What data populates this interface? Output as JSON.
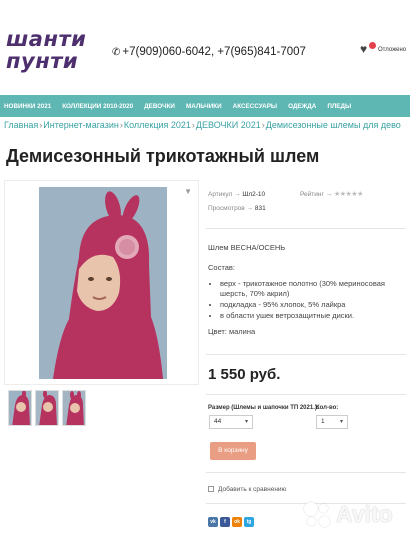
{
  "header": {
    "logo_line1": "шанти",
    "logo_line2": "пунти",
    "phones": "+7(909)060-6042, +7(965)841-7007",
    "wishlist_label": "Отложено"
  },
  "nav": {
    "items": [
      "Новинки 2021",
      "Коллекции 2010-2020",
      "Девочки",
      "Мальчики",
      "Аксессуары",
      "Одежда",
      "Пледы"
    ]
  },
  "breadcrumb": {
    "items": [
      "Главная",
      "Интернет-магазин",
      "Коллекция 2021",
      "ДЕВОЧКИ 2021",
      "Демисезонные шлемы для дево"
    ]
  },
  "product": {
    "title": "Демисезонный трикотажный шлем",
    "article_label": "Артикул →",
    "article_value": "Шл2-10",
    "views_label": "Просмотров →",
    "views_value": "831",
    "rating_label": "Рейтинг →",
    "description": {
      "season": "Шлем ВЕСНА/ОСЕНЬ",
      "composition_label": "Состав:",
      "composition_items": [
        "верх - трикотажное полотно (30% мериносовая шерсть, 70% акрил)",
        "подкладка - 95% хлопок, 5% лайкра",
        "в области ушек ветрозащитные диски."
      ],
      "color": "Цвет: малина"
    },
    "price": "1 550 руб.",
    "size_label": "Размер (Шлемы и шапочки ТП 2021.):",
    "size_value": "44",
    "qty_label": "Кол-во:",
    "qty_value": "1",
    "cart_button": "В корзину",
    "compare_label": "Добавить к сравнению"
  },
  "share": {
    "icons": [
      "vk-icon",
      "facebook-icon",
      "ok-icon",
      "telegram-icon"
    ],
    "labels": [
      "vk",
      "f",
      "ok",
      "tg"
    ]
  },
  "watermark": "Avito",
  "colors": {
    "nav_bg": "#5fb7b3",
    "link": "#3aa2a3",
    "cart_button": "#e99e84",
    "product_color": "#b6325f",
    "logo": "#4d2f6e"
  }
}
